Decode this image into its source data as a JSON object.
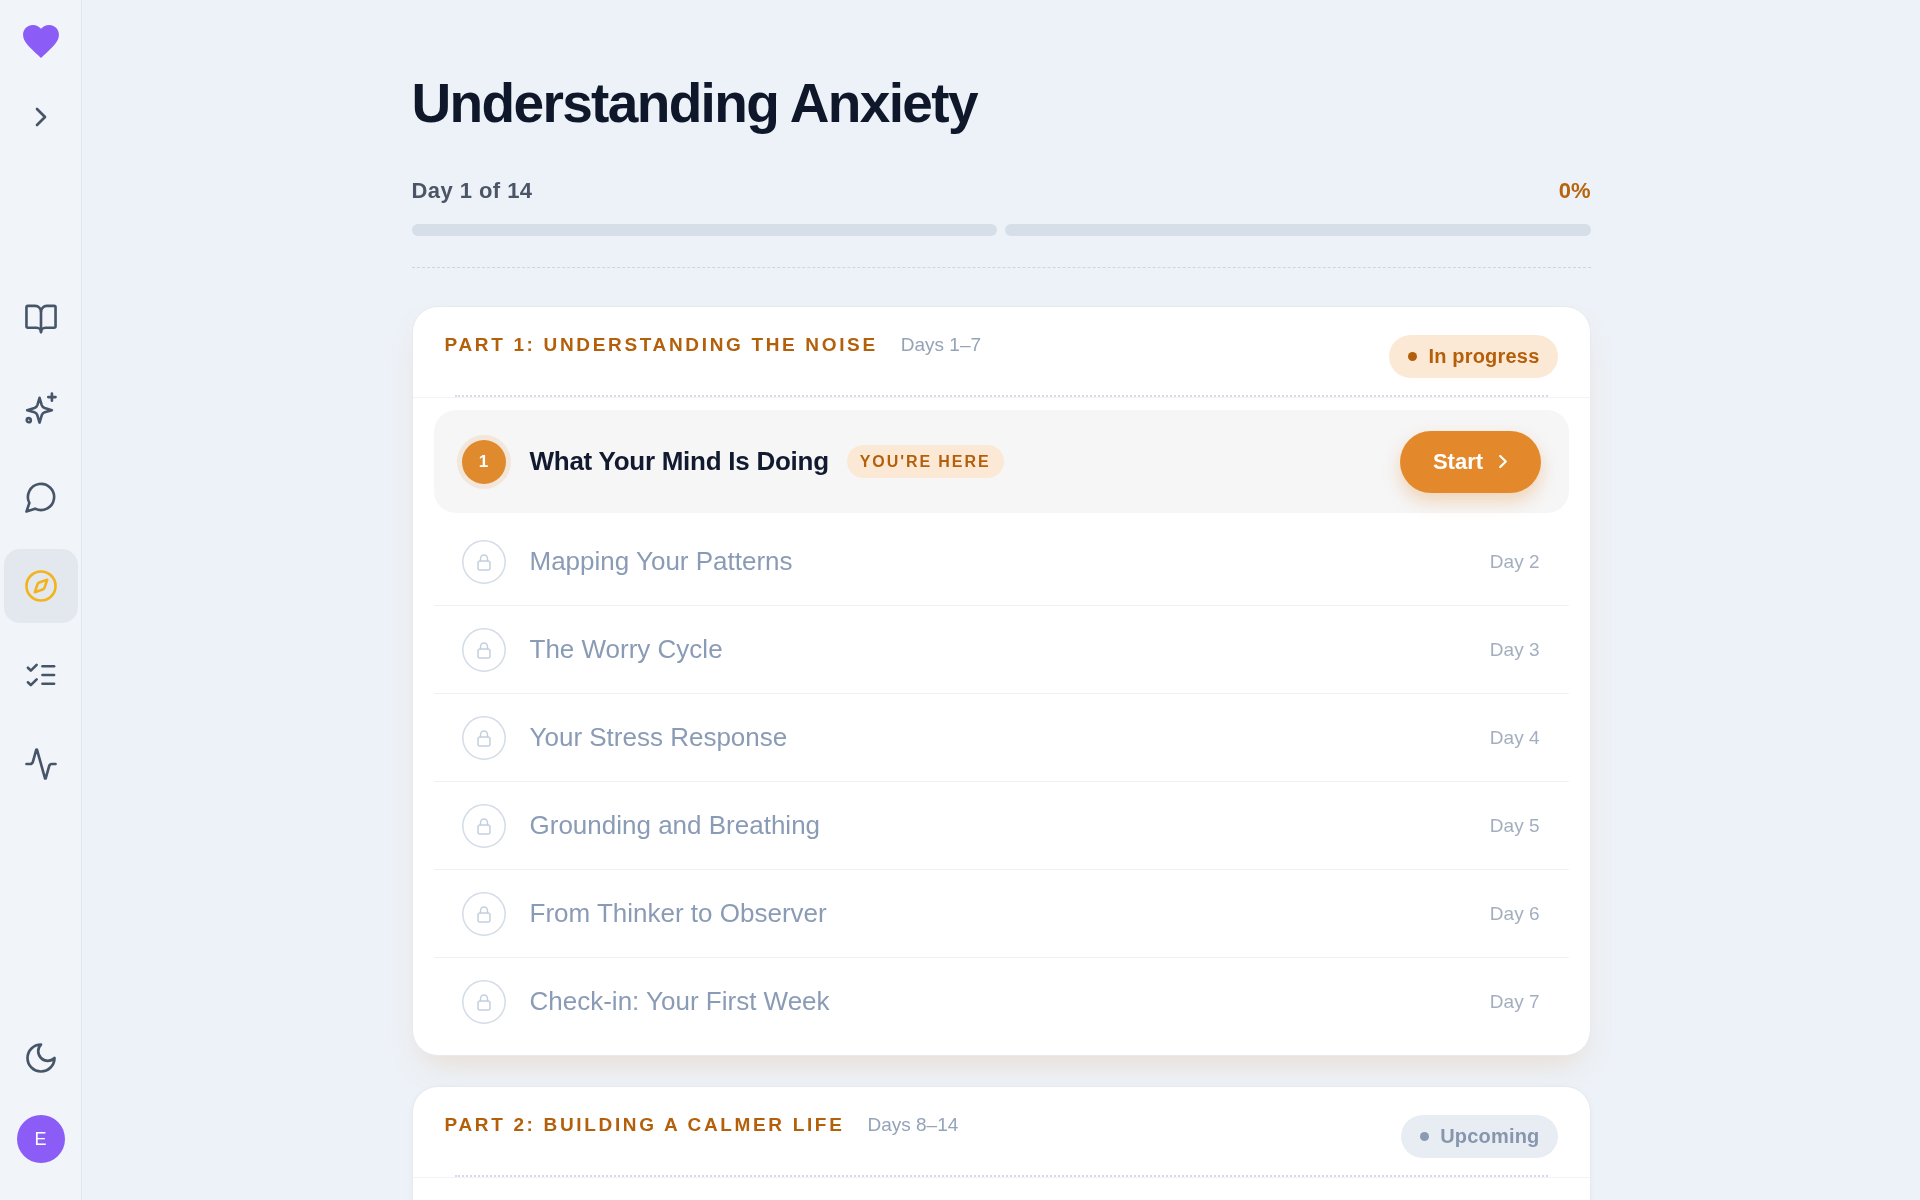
{
  "sidebar": {
    "nav_items": [
      {
        "kind": "book",
        "selected": false
      },
      {
        "kind": "sparkles",
        "selected": false
      },
      {
        "kind": "chat",
        "selected": false
      },
      {
        "kind": "compass",
        "selected": true
      },
      {
        "kind": "checklist",
        "selected": false
      },
      {
        "kind": "activity",
        "selected": false
      }
    ],
    "avatar": {
      "initial": "E"
    }
  },
  "page": {
    "title": "Understanding Anxiety",
    "progress": {
      "label": "Day 1 of 14",
      "percent": "0%",
      "segments": [
        {
          "level": 0
        },
        {
          "level": 0
        }
      ]
    },
    "parts": [
      {
        "title": "PART 1: UNDERSTANDING THE NOISE",
        "days": "Days 1–7",
        "status": {
          "kind": "in_progress",
          "label": "In progress"
        },
        "lessons": [
          {
            "kind": "current",
            "number": "1",
            "title": "What Your Mind Is Doing",
            "badge": "YOU'RE HERE",
            "action": "Start"
          },
          {
            "kind": "locked",
            "title": "Mapping Your Patterns",
            "day": "Day 2"
          },
          {
            "kind": "locked",
            "title": "The Worry Cycle",
            "day": "Day 3"
          },
          {
            "kind": "locked",
            "title": "Your Stress Response",
            "day": "Day 4"
          },
          {
            "kind": "locked",
            "title": "Grounding and Breathing",
            "day": "Day 5"
          },
          {
            "kind": "locked",
            "title": "From Thinker to Observer",
            "day": "Day 6"
          },
          {
            "kind": "locked",
            "title": "Check-in: Your First Week",
            "day": "Day 7"
          }
        ]
      },
      {
        "title": "PART 2: BUILDING A CALMER LIFE",
        "days": "Days 8–14",
        "status": {
          "kind": "upcoming",
          "label": "Upcoming"
        }
      }
    ]
  }
}
